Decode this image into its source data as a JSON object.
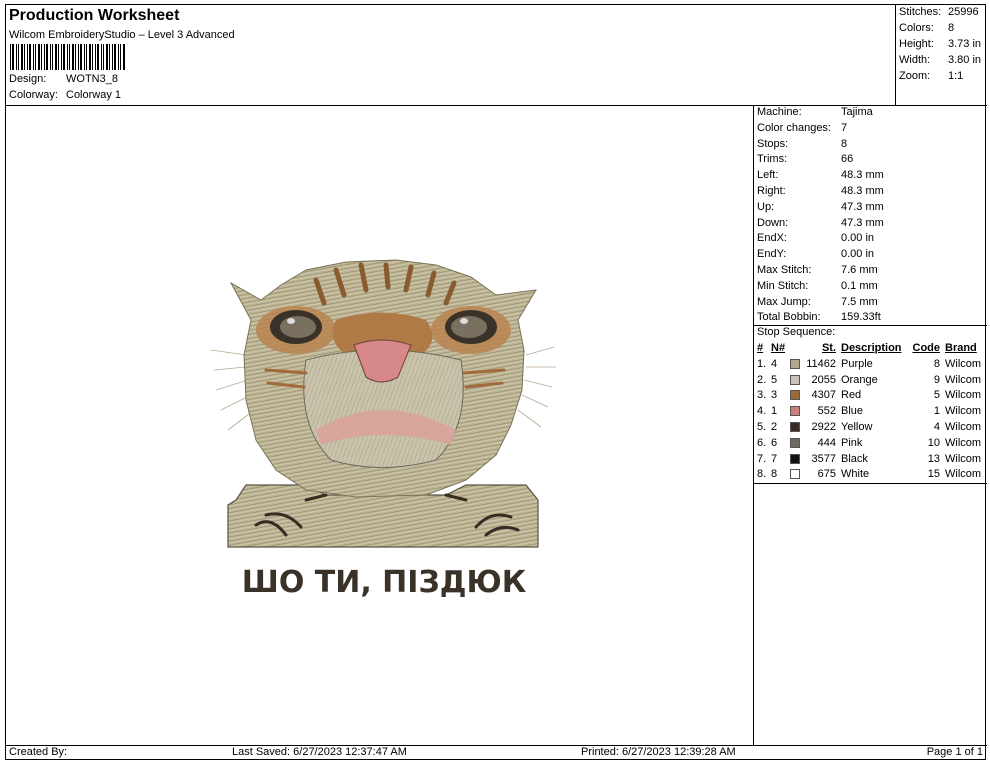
{
  "header": {
    "title": "Production Worksheet",
    "subtitle": "Wilcom EmbroideryStudio – Level 3 Advanced",
    "design_label": "Design:",
    "design_value": "WOTN3_8",
    "colorway_label": "Colorway:",
    "colorway_value": "Colorway 1"
  },
  "stats": [
    {
      "label": "Stitches:",
      "value": "25996"
    },
    {
      "label": "Colors:",
      "value": "8"
    },
    {
      "label": "Height:",
      "value": "3.73 in"
    },
    {
      "label": "Width:",
      "value": "3.80 in"
    },
    {
      "label": "Zoom:",
      "value": "1:1"
    }
  ],
  "machine_info": [
    {
      "label": "Machine:",
      "value": "Tajima"
    },
    {
      "label": "Color changes:",
      "value": "7"
    },
    {
      "label": "Stops:",
      "value": "8"
    },
    {
      "label": "Trims:",
      "value": "66"
    },
    {
      "label": "Left:",
      "value": "48.3 mm"
    },
    {
      "label": "Right:",
      "value": "48.3 mm"
    },
    {
      "label": "Up:",
      "value": "47.3 mm"
    },
    {
      "label": "Down:",
      "value": "47.3 mm"
    },
    {
      "label": "EndX:",
      "value": "0.00 in"
    },
    {
      "label": "EndY:",
      "value": "0.00 in"
    },
    {
      "label": "Max Stitch:",
      "value": "7.6 mm"
    },
    {
      "label": "Min Stitch:",
      "value": "0.1 mm"
    },
    {
      "label": "Max Jump:",
      "value": "7.5 mm"
    },
    {
      "label": "Total Bobbin:",
      "value": "159.33ft"
    }
  ],
  "stop_sequence": {
    "title": "Stop Sequence:",
    "headers": {
      "num": "#",
      "n": "N#",
      "st": "St.",
      "description": "Description",
      "code": "Code",
      "brand": "Brand"
    },
    "rows": [
      {
        "num": "1.",
        "n": "4",
        "color": "#b3a68f",
        "st": "11462",
        "description": "Purple",
        "code": "8",
        "brand": "Wilcom"
      },
      {
        "num": "2.",
        "n": "5",
        "color": "#c8c3b7",
        "st": "2055",
        "description": "Orange",
        "code": "9",
        "brand": "Wilcom"
      },
      {
        "num": "3.",
        "n": "3",
        "color": "#9a6a3c",
        "st": "4307",
        "description": "Red",
        "code": "5",
        "brand": "Wilcom"
      },
      {
        "num": "4.",
        "n": "1",
        "color": "#c8807a",
        "st": "552",
        "description": "Blue",
        "code": "1",
        "brand": "Wilcom"
      },
      {
        "num": "5.",
        "n": "2",
        "color": "#3a2a22",
        "st": "2922",
        "description": "Yellow",
        "code": "4",
        "brand": "Wilcom"
      },
      {
        "num": "6.",
        "n": "6",
        "color": "#6e6a5c",
        "st": "444",
        "description": "Pink",
        "code": "10",
        "brand": "Wilcom"
      },
      {
        "num": "7.",
        "n": "7",
        "color": "#111111",
        "st": "3577",
        "description": "Black",
        "code": "13",
        "brand": "Wilcom"
      },
      {
        "num": "8.",
        "n": "8",
        "color": "#ffffff",
        "st": "675",
        "description": "White",
        "code": "15",
        "brand": "Wilcom"
      }
    ]
  },
  "design_caption": "ШО ТИ, ПІЗДЮК",
  "footer": {
    "created_by": "Created By:",
    "last_saved": "Last Saved: 6/27/2023 12:37:47 AM",
    "printed": "Printed: 6/27/2023 12:39:28 AM",
    "page": "Page 1 of 1"
  }
}
